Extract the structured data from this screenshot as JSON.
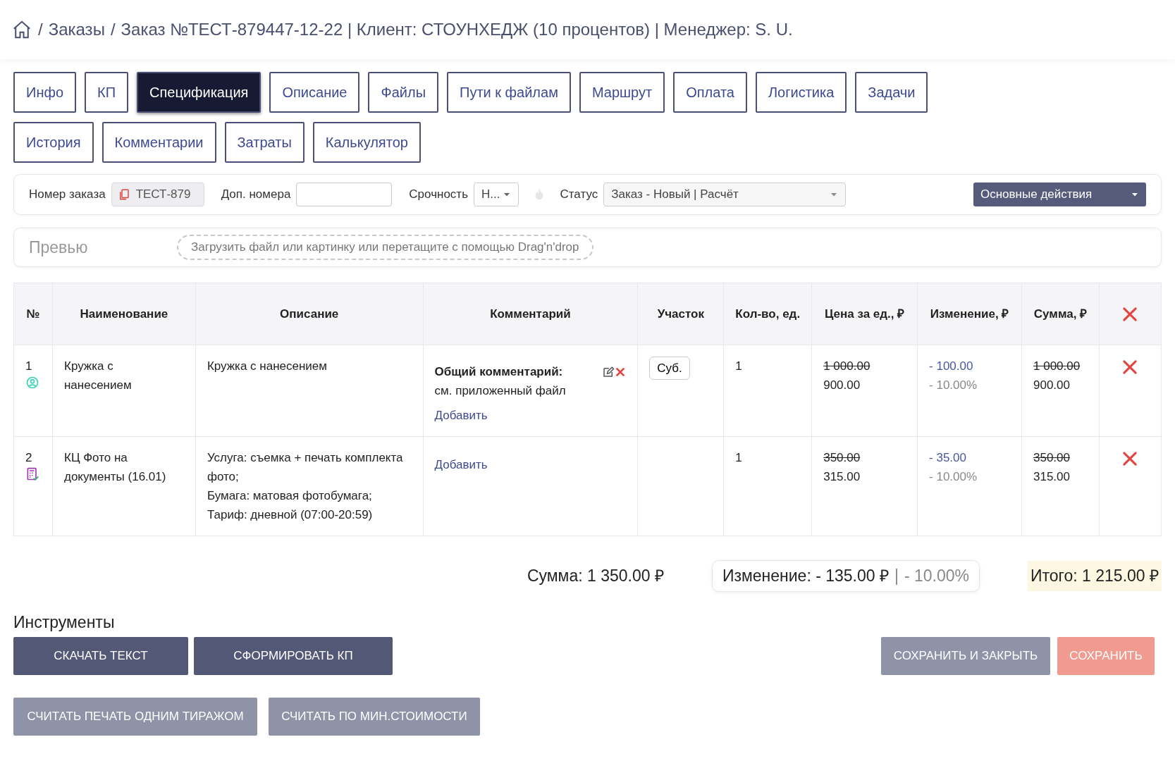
{
  "breadcrumb": {
    "separator": "/",
    "items": [
      "Заказы",
      "Заказ №ТЕСТ-879447-12-22 | Клиент: СТОУНХЕДЖ (10 процентов) | Менеджер: S. U."
    ]
  },
  "tabs": [
    {
      "label": "Инфо",
      "selected": false
    },
    {
      "label": "КП",
      "selected": false
    },
    {
      "label": "Спецификация",
      "selected": true
    },
    {
      "label": "Описание",
      "selected": false
    },
    {
      "label": "Файлы",
      "selected": false
    },
    {
      "label": "Пути к файлам",
      "selected": false
    },
    {
      "label": "Маршрут",
      "selected": false
    },
    {
      "label": "Оплата",
      "selected": false
    },
    {
      "label": "Логистика",
      "selected": false
    },
    {
      "label": "Задачи",
      "selected": false
    },
    {
      "label": "История",
      "selected": false
    },
    {
      "label": "Комментарии",
      "selected": false
    },
    {
      "label": "Затраты",
      "selected": false
    },
    {
      "label": "Калькулятор",
      "selected": false
    }
  ],
  "order_bar": {
    "order_number_label": "Номер заказа",
    "order_number": "ТЕСТ-879",
    "extra_numbers_label": "Доп. номера",
    "urgency_label": "Срочность",
    "urgency": "Н...",
    "status_label": "Статус",
    "status": "Заказ - Новый | Расчёт",
    "actions": "Основные действия"
  },
  "preview": {
    "label": "Превью",
    "dropzone": "Загрузить файл или картинку или перетащите с помощью Drag'n'drop"
  },
  "table": {
    "columns": [
      "№",
      "Наименование",
      "Описание",
      "Комментарий",
      "Участок",
      "Кол-во, ед.",
      "Цена за ед., ₽",
      "Изменение, ₽",
      "Сумма, ₽"
    ],
    "rows": [
      {
        "num": "1",
        "kind": "person",
        "name": "Кружка с нанесением",
        "description": [
          "Кружка с нанесением"
        ],
        "comment": {
          "title": "Общий комментарий:",
          "text": "см. приложенный файл"
        },
        "add": "Добавить",
        "section": "Суб.",
        "qty": "1",
        "price_old": "1 000.00",
        "price": "900.00",
        "change": "- 100.00",
        "change_pct": "- 10.00%",
        "sum_old": "1 000.00",
        "sum": "900.00"
      },
      {
        "num": "2",
        "kind": "calculator",
        "name": "КЦ Фото на документы (16.01)",
        "description": [
          "Услуга: съемка + печать комплекта фото;",
          "Бумага: матовая фотобумага;",
          "Тариф: дневной (07:00-20:59)"
        ],
        "add": "Добавить",
        "qty": "1",
        "price_old": "350.00",
        "price": "315.00",
        "change": "- 35.00",
        "change_pct": "- 10.00%",
        "sum_old": "350.00",
        "sum": "315.00"
      }
    ]
  },
  "totals": {
    "sum": "Сумма: 1 350.00 ₽",
    "change": "Изменение: - 135.00 ₽",
    "separator": "|",
    "change_pct": "- 10.00%",
    "total": "Итого: 1 215.00 ₽"
  },
  "tools": {
    "title": "Инструменты",
    "left": [
      {
        "label": "СКАЧАТЬ ТЕКСТ",
        "kind": "dark"
      },
      {
        "label": "СФОРМИРОВАТЬ КП",
        "kind": "dark"
      }
    ],
    "right": [
      {
        "label": "СОХРАНИТЬ И ЗАКРЫТЬ",
        "kind": "grey"
      },
      {
        "label": "СОХРАНИТЬ",
        "kind": "salmon"
      }
    ],
    "second": [
      {
        "label": "СЧИТАТЬ ПЕЧАТЬ ОДНИМ ТИРАЖОМ",
        "kind": "grey"
      },
      {
        "label": "СЧИТАТЬ ПО МИН.СТОИМОСТИ",
        "kind": "grey"
      }
    ]
  }
}
